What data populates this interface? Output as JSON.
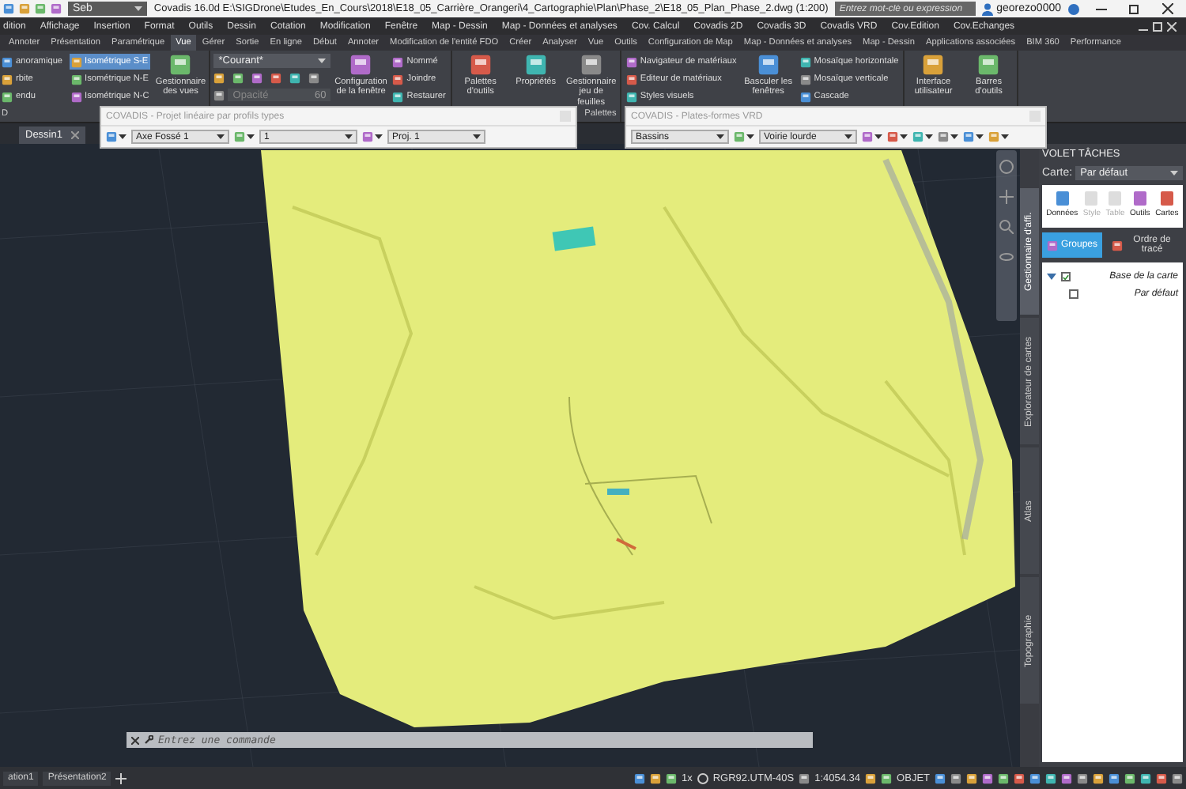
{
  "title_bar": {
    "workspace": "Seb",
    "title": "Covadis 16.0d   E:\\SIGDrone\\Etudes_En_Cours\\2018\\E18_05_Carrière_Orangeri\\4_Cartographie\\Plan\\Phase_2\\E18_05_Plan_Phase_2.dwg (1:200)",
    "search": {
      "placeholder": "Entrez mot-clé ou expression"
    },
    "user": "georezo0000"
  },
  "menu_bar": [
    "dition",
    "Affichage",
    "Insertion",
    "Format",
    "Outils",
    "Dessin",
    "Cotation",
    "Modification",
    "Fenêtre",
    "Map - Dessin",
    "Map - Données et analyses",
    "Cov. Calcul",
    "Covadis 2D",
    "Covadis 3D",
    "Covadis VRD",
    "Cov.Edition",
    "Cov.Echanges"
  ],
  "ribbon_tabs": [
    {
      "label": "Annoter",
      "selected": false
    },
    {
      "label": "Présentation",
      "selected": false
    },
    {
      "label": "Paramétrique",
      "selected": false
    },
    {
      "label": "Vue",
      "selected": true
    },
    {
      "label": "Gérer",
      "selected": false
    },
    {
      "label": "Sortie",
      "selected": false
    },
    {
      "label": "En ligne",
      "selected": false
    },
    {
      "label": "Début",
      "selected": false
    },
    {
      "label": "Annoter",
      "selected": false
    },
    {
      "label": "Modification de l'entité FDO",
      "selected": false
    },
    {
      "label": "Créer",
      "selected": false
    },
    {
      "label": "Analyser",
      "selected": false
    },
    {
      "label": "Vue",
      "selected": false
    },
    {
      "label": "Outils",
      "selected": false
    },
    {
      "label": "Configuration de Map",
      "selected": false
    },
    {
      "label": "Map - Données et analyses",
      "selected": false
    },
    {
      "label": "Map - Dessin",
      "selected": false
    },
    {
      "label": "Applications associées",
      "selected": false
    },
    {
      "label": "BIM 360",
      "selected": false
    },
    {
      "label": "Performance",
      "selected": false
    }
  ],
  "ribbon_panels": [
    {
      "label": "D",
      "items": [
        {
          "kind": "stack",
          "entries": [
            {
              "label": "anoramique"
            },
            {
              "label": "rbite"
            },
            {
              "label": "endu"
            }
          ]
        },
        {
          "kind": "stack",
          "entries": [
            {
              "label": "Isométrique S-E",
              "selected": true
            },
            {
              "label": "Isométrique N-E",
              "selected": false
            },
            {
              "label": "Isométrique N-C",
              "selected": false
            }
          ]
        },
        {
          "kind": "large",
          "label": "Gestionnaire des vues"
        }
      ]
    },
    {
      "items": [
        {
          "kind": "visual_style",
          "style": "*Courant*",
          "opacity_label": "Opacité",
          "opacity_value": "60"
        },
        {
          "kind": "large",
          "label": "Configuration de la fenêtre"
        },
        {
          "kind": "stack",
          "entries": [
            {
              "label": "Nommé"
            },
            {
              "label": "Joindre"
            },
            {
              "label": "Restaurer"
            }
          ]
        }
      ]
    },
    {
      "label": "Palettes",
      "items": [
        {
          "kind": "large",
          "label": "Palettes d'outils"
        },
        {
          "kind": "large",
          "label": "Propriétés"
        },
        {
          "kind": "large",
          "label": "Gestionnaire jeu de feuilles"
        }
      ]
    },
    {
      "items": [
        {
          "kind": "stack",
          "entries": [
            {
              "label": "Navigateur de matériaux"
            },
            {
              "label": "Editeur de matériaux"
            },
            {
              "label": "Styles visuels"
            }
          ]
        },
        {
          "kind": "large",
          "label": "Basculer les fenêtres"
        },
        {
          "kind": "stack",
          "entries": [
            {
              "label": "Mosaïque horizontale"
            },
            {
              "label": "Mosaïque verticale"
            },
            {
              "label": "Cascade"
            }
          ]
        }
      ]
    },
    {
      "items": [
        {
          "kind": "large",
          "label": "Interface utilisateur"
        },
        {
          "kind": "large",
          "label": "Barres d'outils"
        }
      ]
    }
  ],
  "document_tabs": [
    {
      "label": "Dessin1",
      "selected": true
    }
  ],
  "toolbars": [
    {
      "title": "COVADIS - Projet linéaire par profils types",
      "dropdowns": [
        "Axe Fossé 1",
        "1",
        "Proj. 1"
      ]
    },
    {
      "title": "COVADIS - Plates-formes VRD",
      "dropdowns": [
        "Bassins",
        "Voirie lourde"
      ]
    }
  ],
  "side_tabs": [
    {
      "label": "Gestionnaire d'affi.",
      "selected": true
    },
    {
      "label": "Explorateur de cartes",
      "selected": false
    },
    {
      "label": "Atlas",
      "selected": false
    },
    {
      "label": "Topographie",
      "selected": false
    }
  ],
  "task_pane": {
    "title": "VOLET TÂCHES",
    "map_label": "Carte:",
    "map_value": "Par défaut",
    "tools": [
      {
        "label": "Données",
        "disabled": false
      },
      {
        "label": "Style",
        "disabled": true
      },
      {
        "label": "Table",
        "disabled": true
      },
      {
        "label": "Outils",
        "disabled": false
      },
      {
        "label": "Cartes",
        "disabled": false
      }
    ],
    "views": [
      {
        "label": "Groupes",
        "selected": true
      },
      {
        "label": "Ordre de tracé",
        "selected": false
      }
    ],
    "tree": [
      {
        "label": "Base de la carte",
        "checked": true,
        "expanded": true,
        "children": [
          {
            "label": "Par défaut",
            "checked": false
          }
        ]
      }
    ]
  },
  "command_line": {
    "placeholder": "Entrez une commande"
  },
  "layout_tabs": [
    {
      "label": "ation1",
      "selected": false
    },
    {
      "label": "Présentation2",
      "selected": false
    }
  ],
  "status_bar": {
    "scale_factor": "1x",
    "coordinate_system": "RGR92.UTM-40S",
    "scale": "1:4054.34",
    "snap_mode": "OBJET"
  }
}
